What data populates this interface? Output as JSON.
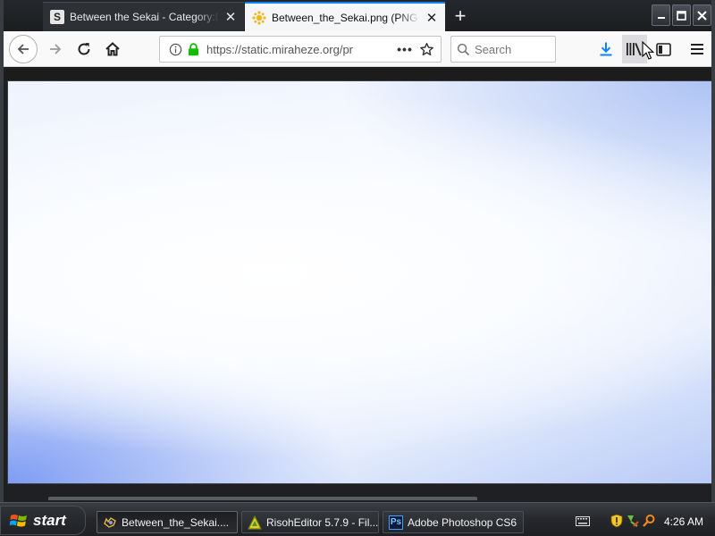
{
  "browser": {
    "tabs": [
      {
        "title": "Between the Sekai - Category:Diet",
        "favicon": "letter-s",
        "active": false
      },
      {
        "title": "Between_the_Sekai.png (PNG Image",
        "favicon": "sun-image-icon",
        "active": true
      }
    ],
    "newtab_symbol": "+",
    "window_controls": {
      "minimize": "–",
      "maximize": "□",
      "close": "✕"
    },
    "url": "https://static.miraheze.org/pr",
    "page_actions_symbol": "•••",
    "search_placeholder": "Search"
  },
  "favicon_letter": "S",
  "taskbar": {
    "start_label": "start",
    "tasks": [
      {
        "label": "Between_the_Sekai....",
        "icon": "firefox-icon"
      },
      {
        "label": "RisohEditor 5.7.9 - Fil...",
        "icon": "risoh-editor-icon"
      },
      {
        "label": "Adobe Photoshop CS6",
        "icon": "photoshop-icon",
        "icon_text": "Ps"
      }
    ],
    "clock": "4:26 AM"
  },
  "colors": {
    "accent": "#0a84ff",
    "secure_lock": "#12bc00",
    "download": "#0a84ff"
  }
}
